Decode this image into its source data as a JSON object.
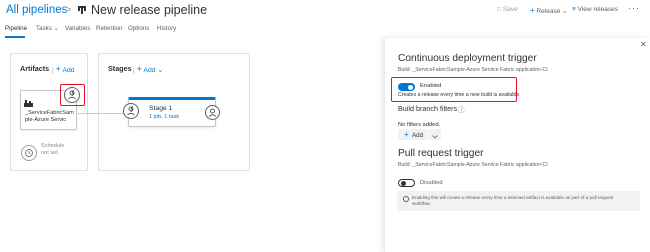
{
  "header": {
    "breadcrumb_root": "All pipelines",
    "breadcrumb_sep": ">",
    "title": "New release pipeline",
    "actions": {
      "save": "Save",
      "release": "Release",
      "view_releases": "View releases",
      "more": "···"
    }
  },
  "tabs": [
    {
      "label": "Pipeline",
      "active": true
    },
    {
      "label": "Tasks",
      "active": false
    },
    {
      "label": "Variables",
      "active": false
    },
    {
      "label": "Retention",
      "active": false
    },
    {
      "label": "Options",
      "active": false
    },
    {
      "label": "History",
      "active": false
    }
  ],
  "canvas": {
    "artifacts": {
      "title": "Artifacts",
      "add_label": "Add",
      "artifact_name": "_ServiceFabricSam ple-Azure Servic",
      "schedule_label": "Schedule not set"
    },
    "stages": {
      "title": "Stages",
      "add_label": "Add",
      "stage_name": "Stage 1",
      "stage_tasks": "1 job, 1 task"
    }
  },
  "panel": {
    "cd_title": "Continuous deployment trigger",
    "cd_subtitle": "Build: _ServiceFabricSample-Azure Service Fabric application-CI",
    "cd_toggle_label": "Enabled",
    "cd_toggle_on": true,
    "cd_description": "Creates a release every time a new build is available.",
    "filters_title": "Build branch filters",
    "no_filters": "No filters added.",
    "add_label": "Add",
    "pr_title": "Pull request trigger",
    "pr_subtitle": "Build: _ServiceFabricSample-Azure Service Fabric application-CI",
    "pr_toggle_label": "Disabled",
    "pr_toggle_on": false,
    "pr_info": "Enabling this will create a release every time a selected artifact is available as part of a pull request workflow"
  },
  "colors": {
    "accent": "#0078d4",
    "highlight": "#e81123"
  },
  "icons": [
    "pipeline-icon",
    "plus-icon",
    "chevron-down-icon",
    "lightning-person-icon",
    "clock-icon",
    "info-icon",
    "close-icon",
    "artifact-build-icon"
  ]
}
